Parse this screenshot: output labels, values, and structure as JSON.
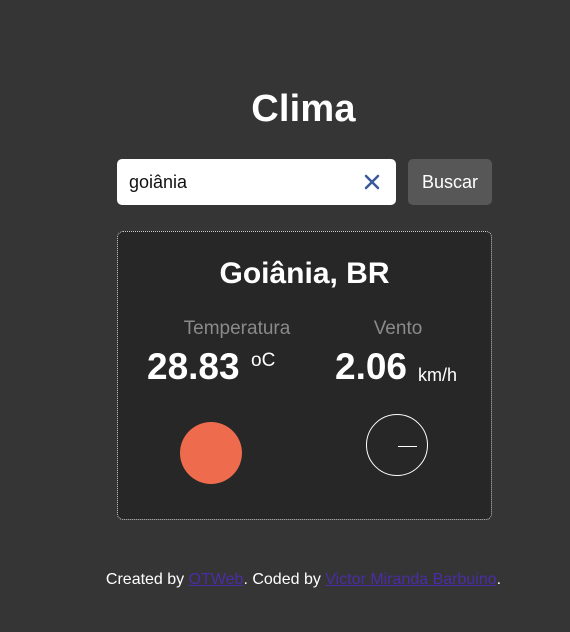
{
  "app": {
    "title": "Clima"
  },
  "search": {
    "value": "goiânia",
    "button_label": "Buscar",
    "clear_icon": "close-icon"
  },
  "weather": {
    "city": "Goiânia, BR",
    "temperature": {
      "label": "Temperatura",
      "value": "28.83",
      "unit": "oC",
      "indicator_color": "#ee6b4e"
    },
    "wind": {
      "label": "Vento",
      "value": "2.06",
      "unit": "km/h",
      "direction_icon": "wind-direction-icon"
    }
  },
  "footer": {
    "prefix": "Created by ",
    "creator_link": "OTWeb",
    "middle": ". Coded by ",
    "coder_link": "Victor Miranda Barbuino",
    "suffix": "."
  },
  "colors": {
    "background": "#353535",
    "card": "#272727",
    "button": "#575757",
    "link": "#4a2da6",
    "clear_icon": "#3b5a9a"
  }
}
